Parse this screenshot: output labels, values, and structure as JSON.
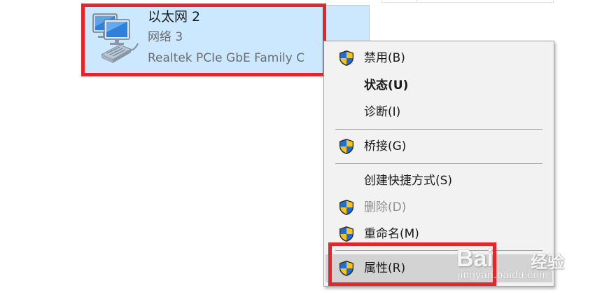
{
  "adapter": {
    "name": "以太网 2",
    "network": "网络 3",
    "device": "Realtek PCIe GbE Family C"
  },
  "menu": {
    "items": [
      {
        "label": "禁用(B)",
        "shield": true,
        "bold": false,
        "disabled": false
      },
      {
        "label": "状态(U)",
        "shield": false,
        "bold": true,
        "disabled": false
      },
      {
        "label": "诊断(I)",
        "shield": false,
        "bold": false,
        "disabled": false
      },
      {
        "label": "桥接(G)",
        "shield": true,
        "bold": false,
        "disabled": false
      },
      {
        "label": "创建快捷方式(S)",
        "shield": false,
        "bold": false,
        "disabled": false
      },
      {
        "label": "删除(D)",
        "shield": true,
        "bold": false,
        "disabled": true
      },
      {
        "label": "重命名(M)",
        "shield": true,
        "bold": false,
        "disabled": false
      },
      {
        "label": "属性(R)",
        "shield": true,
        "bold": false,
        "disabled": false,
        "hovered": true
      }
    ]
  },
  "watermark": {
    "brand": "Bai",
    "brand_suffix": "经验",
    "url": "jingyan.baidu.com"
  },
  "colors": {
    "selection_bg": "#cce8ff",
    "highlight_red": "#e8232a",
    "menu_bg": "#f2f2f2",
    "hover_bg": "#d3d3d3",
    "shield_blue": "#1e6fd0",
    "shield_yellow": "#f3c321"
  }
}
